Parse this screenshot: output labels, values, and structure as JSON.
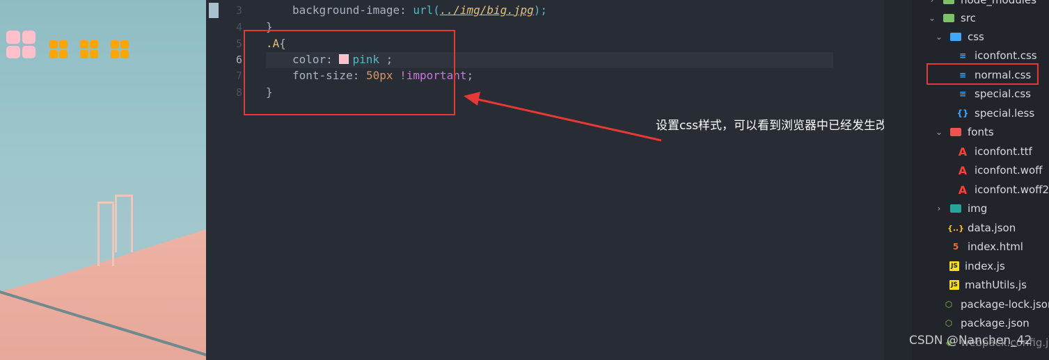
{
  "preview": {
    "big_icons": 1,
    "small_icons": 3,
    "big_icon_color": "#ffc0cb",
    "small_icon_color": "#ffa500"
  },
  "editor": {
    "line_numbers": [
      "3",
      "4",
      "5",
      "6",
      "7",
      "8"
    ],
    "active_line": "6",
    "lines": {
      "l3_prop": "background-image: ",
      "l3_fn": "url(",
      "l3_arg": "../img/big.jpg",
      "l3_end": ");",
      "l4": "}",
      "l5_sel": ".A",
      "l5_brace": "{",
      "l6_prop": "color: ",
      "l6_val": "pink",
      "l6_end": " ;",
      "l7_prop": "font-size: ",
      "l7_num": "50px",
      "l7_imp": " !important",
      "l7_end": ";",
      "l8": "}"
    },
    "annotation": "设置css样式，可以看到浏览器中已经发生改变",
    "colors": {
      "highlight": "#e53935",
      "pink": "#ffc0cb"
    }
  },
  "explorer": {
    "items": [
      {
        "label": "node_modules",
        "icon": "node-folder-icon"
      },
      {
        "label": "src",
        "icon": "src-folder-icon"
      },
      {
        "label": "css",
        "icon": "css-folder-icon"
      },
      {
        "label": "iconfont.css",
        "icon": "css3-icon"
      },
      {
        "label": "normal.css",
        "icon": "css3-icon"
      },
      {
        "label": "special.css",
        "icon": "css3-icon"
      },
      {
        "label": "special.less",
        "icon": "braces-icon"
      },
      {
        "label": "fonts",
        "icon": "fonts-folder-icon"
      },
      {
        "label": "iconfont.ttf",
        "icon": "font-icon"
      },
      {
        "label": "iconfont.woff",
        "icon": "font-icon"
      },
      {
        "label": "iconfont.woff2",
        "icon": "font-icon"
      },
      {
        "label": "img",
        "icon": "img-folder-icon"
      },
      {
        "label": "data.json",
        "icon": "json-icon"
      },
      {
        "label": "index.html",
        "icon": "html5-icon"
      },
      {
        "label": "index.js",
        "icon": "js-icon"
      },
      {
        "label": "mathUtils.js",
        "icon": "js-icon"
      },
      {
        "label": "package-lock.json",
        "icon": "nodejs-icon"
      },
      {
        "label": "package.json",
        "icon": "nodejs-icon"
      },
      {
        "label": "webpack.config.js",
        "icon": "webpack-icon"
      }
    ],
    "selected": "normal.css"
  },
  "watermark": "CSDN @Nanchen_42"
}
